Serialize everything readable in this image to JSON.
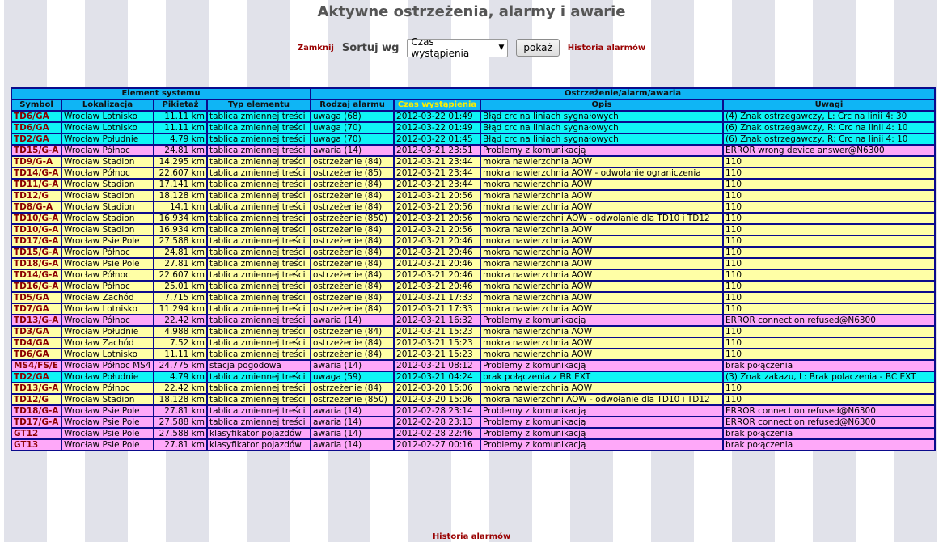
{
  "title": "Aktywne ostrzeżenia, alarmy i awarie",
  "controls": {
    "close_label": "Zamknij",
    "sort_label": "Sortuj wg",
    "sort_selected": "Czas wystąpienia",
    "show_button": "pokaż",
    "history_label": "Historia alarmów"
  },
  "table": {
    "group_headers": [
      "Element systemu",
      "Ostrzeżenie/alarm/awaria"
    ],
    "columns": [
      "Symbol",
      "Lokalizacja",
      "Pikietaż",
      "Typ elementu",
      "Rodzaj alarmu",
      "Czas wystąpienia",
      "Opis",
      "Uwagi"
    ],
    "rows": [
      {
        "type": "info",
        "cells": [
          "TD6/GA",
          "Wrocław Lotnisko",
          "11.11 km",
          "tablica zmiennej treści",
          "uwaga (68)",
          "2012-03-22 01:49",
          "Błąd crc na liniach sygnałowych",
          "(4) Znak ostrzegawczy, L: Crc na linii 4: 30"
        ]
      },
      {
        "type": "info",
        "cells": [
          "TD6/GA",
          "Wrocław Lotnisko",
          "11.11 km",
          "tablica zmiennej treści",
          "uwaga (70)",
          "2012-03-22 01:49",
          "Błąd crc na liniach sygnałowych",
          "(6) Znak ostrzegawczy, R: Crc na linii 4: 10"
        ]
      },
      {
        "type": "info",
        "cells": [
          "TD2/GA",
          "Wrocław Południe",
          "4.79 km",
          "tablica zmiennej treści",
          "uwaga (70)",
          "2012-03-22 01:45",
          "Błąd crc na liniach sygnałowych",
          "(6) Znak ostrzegawczy, R: Crc na linii 4: 10"
        ]
      },
      {
        "type": "alarm",
        "cells": [
          "TD15/G-A",
          "Wrocław Północ",
          "24.81 km",
          "tablica zmiennej treści",
          "awaria (14)",
          "2012-03-21 23:51",
          "Problemy z komunikacją",
          "ERROR wrong device answer@N6300"
        ]
      },
      {
        "type": "warn",
        "cells": [
          "TD9/G-A",
          "Wrocław Stadion",
          "14.295 km",
          "tablica zmiennej treści",
          "ostrzeżenie (84)",
          "2012-03-21 23:44",
          "mokra nawierzchnia AOW",
          "110"
        ]
      },
      {
        "type": "warn",
        "cells": [
          "TD14/G-A",
          "Wrocław Północ",
          "22.607 km",
          "tablica zmiennej treści",
          "ostrzeżenie (85)",
          "2012-03-21 23:44",
          "mokra nawierzchnia AOW - odwołanie ograniczenia",
          "110"
        ]
      },
      {
        "type": "warn",
        "cells": [
          "TD11/G-A",
          "Wrocław Stadion",
          "17.141 km",
          "tablica zmiennej treści",
          "ostrzeżenie (84)",
          "2012-03-21 23:44",
          "mokra nawierzchnia AOW",
          "110"
        ]
      },
      {
        "type": "warn",
        "cells": [
          "TD12/G",
          "Wrocław Stadion",
          "18.128 km",
          "tablica zmiennej treści",
          "ostrzeżenie (84)",
          "2012-03-21 20:56",
          "mokra nawierzchnia AOW",
          "110"
        ]
      },
      {
        "type": "warn",
        "cells": [
          "TD8/G-A",
          "Wrocław Stadion",
          "14.1 km",
          "tablica zmiennej treści",
          "ostrzeżenie (84)",
          "2012-03-21 20:56",
          "mokra nawierzchnia AOW",
          "110"
        ]
      },
      {
        "type": "warn",
        "cells": [
          "TD10/G-A",
          "Wrocław Stadion",
          "16.934 km",
          "tablica zmiennej treści",
          "ostrzeżenie (850)",
          "2012-03-21 20:56",
          "mokra nawierzchni AOW - odwołanie dla TD10 i TD12",
          "110"
        ]
      },
      {
        "type": "warn",
        "cells": [
          "TD10/G-A",
          "Wrocław Stadion",
          "16.934 km",
          "tablica zmiennej treści",
          "ostrzeżenie (84)",
          "2012-03-21 20:56",
          "mokra nawierzchnia AOW",
          "110"
        ]
      },
      {
        "type": "warn",
        "cells": [
          "TD17/G-A",
          "Wrocław Psie Pole",
          "27.588 km",
          "tablica zmiennej treści",
          "ostrzeżenie (84)",
          "2012-03-21 20:46",
          "mokra nawierzchnia AOW",
          "110"
        ]
      },
      {
        "type": "warn",
        "cells": [
          "TD15/G-A",
          "Wrocław Północ",
          "24.81 km",
          "tablica zmiennej treści",
          "ostrzeżenie (84)",
          "2012-03-21 20:46",
          "mokra nawierzchnia AOW",
          "110"
        ]
      },
      {
        "type": "warn",
        "cells": [
          "TD18/G-A",
          "Wrocław Psie Pole",
          "27.81 km",
          "tablica zmiennej treści",
          "ostrzeżenie (84)",
          "2012-03-21 20:46",
          "mokra nawierzchnia AOW",
          "110"
        ]
      },
      {
        "type": "warn",
        "cells": [
          "TD14/G-A",
          "Wrocław Północ",
          "22.607 km",
          "tablica zmiennej treści",
          "ostrzeżenie (84)",
          "2012-03-21 20:46",
          "mokra nawierzchnia AOW",
          "110"
        ]
      },
      {
        "type": "warn",
        "cells": [
          "TD16/G-A",
          "Wrocław Północ",
          "25.01 km",
          "tablica zmiennej treści",
          "ostrzeżenie (84)",
          "2012-03-21 20:46",
          "mokra nawierzchnia AOW",
          "110"
        ]
      },
      {
        "type": "warn",
        "cells": [
          "TD5/GA",
          "Wrocław Zachód",
          "7.715 km",
          "tablica zmiennej treści",
          "ostrzeżenie (84)",
          "2012-03-21 17:33",
          "mokra nawierzchnia AOW",
          "110"
        ]
      },
      {
        "type": "warn",
        "cells": [
          "TD7/GA",
          "Wrocław Lotnisko",
          "11.294 km",
          "tablica zmiennej treści",
          "ostrzeżenie (84)",
          "2012-03-21 17:33",
          "mokra nawierzchnia AOW",
          "110"
        ]
      },
      {
        "type": "alarm",
        "cells": [
          "TD13/G-A",
          "Wrocław Północ",
          "22.42 km",
          "tablica zmiennej treści",
          "awaria (14)",
          "2012-03-21 16:32",
          "Problemy z komunikacją",
          "ERROR connection refused@N6300"
        ]
      },
      {
        "type": "warn",
        "cells": [
          "TD3/GA",
          "Wrocław Południe",
          "4.988 km",
          "tablica zmiennej treści",
          "ostrzeżenie (84)",
          "2012-03-21 15:23",
          "mokra nawierzchnia AOW",
          "110"
        ]
      },
      {
        "type": "warn",
        "cells": [
          "TD4/GA",
          "Wrocław Zachód",
          "7.52 km",
          "tablica zmiennej treści",
          "ostrzeżenie (84)",
          "2012-03-21 15:23",
          "mokra nawierzchnia AOW",
          "110"
        ]
      },
      {
        "type": "warn",
        "cells": [
          "TD6/GA",
          "Wrocław Lotnisko",
          "11.11 km",
          "tablica zmiennej treści",
          "ostrzeżenie (84)",
          "2012-03-21 15:23",
          "mokra nawierzchnia AOW",
          "110"
        ]
      },
      {
        "type": "alarm",
        "cells": [
          "MS4/FS/E",
          "Wrocław Północ MS4",
          "24.775 km",
          "stacja pogodowa",
          "awaria (14)",
          "2012-03-21 08:12",
          "Problemy z komunikacją",
          "brak połączenia"
        ]
      },
      {
        "type": "info",
        "cells": [
          "TD2/GA",
          "Wrocław Południe",
          "4.79 km",
          "tablica zmiennej treści",
          "uwaga (59)",
          "2012-03-21 04:24",
          "brak połączenia z BR EXT",
          "(3) Znak zakazu, L: Brak polaczenia - BC EXT"
        ]
      },
      {
        "type": "warn",
        "cells": [
          "TD13/G-A",
          "Wrocław Północ",
          "22.42 km",
          "tablica zmiennej treści",
          "ostrzeżenie (84)",
          "2012-03-20 15:06",
          "mokra nawierzchnia AOW",
          "110"
        ]
      },
      {
        "type": "warn",
        "cells": [
          "TD12/G",
          "Wrocław Stadion",
          "18.128 km",
          "tablica zmiennej treści",
          "ostrzeżenie (850)",
          "2012-03-20 15:06",
          "mokra nawierzchni AOW - odwołanie dla TD10 i TD12",
          "110"
        ]
      },
      {
        "type": "alarm",
        "cells": [
          "TD18/G-A",
          "Wrocław Psie Pole",
          "27.81 km",
          "tablica zmiennej treści",
          "awaria (14)",
          "2012-02-28 23:14",
          "Problemy z komunikacją",
          "ERROR connection refused@N6300"
        ]
      },
      {
        "type": "alarm",
        "cells": [
          "TD17/G-A",
          "Wrocław Psie Pole",
          "27.588 km",
          "tablica zmiennej treści",
          "awaria (14)",
          "2012-02-28 23:13",
          "Problemy z komunikacją",
          "ERROR connection refused@N6300"
        ]
      },
      {
        "type": "alarm",
        "cells": [
          "GT12",
          "Wrocław Psie Pole",
          "27.588 km",
          "klasyfikator pojazdów",
          "awaria (14)",
          "2012-02-28 22:46",
          "Problemy z komunikacją",
          "brak połączenia"
        ]
      },
      {
        "type": "alarm",
        "cells": [
          "GT13",
          "Wrocław Psie Pole",
          "27.81 km",
          "klasyfikator pojazdów",
          "awaria (14)",
          "2012-02-27 00:16",
          "Problemy z komunikacją",
          "brak połączenia"
        ]
      }
    ]
  },
  "footer": {
    "history_label": "Historia alarmów"
  },
  "colors": {
    "header": "#0fb5f5",
    "warn": "#ffffa6",
    "alarm": "#fea8f9",
    "info": "#0ff5f5",
    "border": "#0b0b8c",
    "link": "#990000"
  }
}
